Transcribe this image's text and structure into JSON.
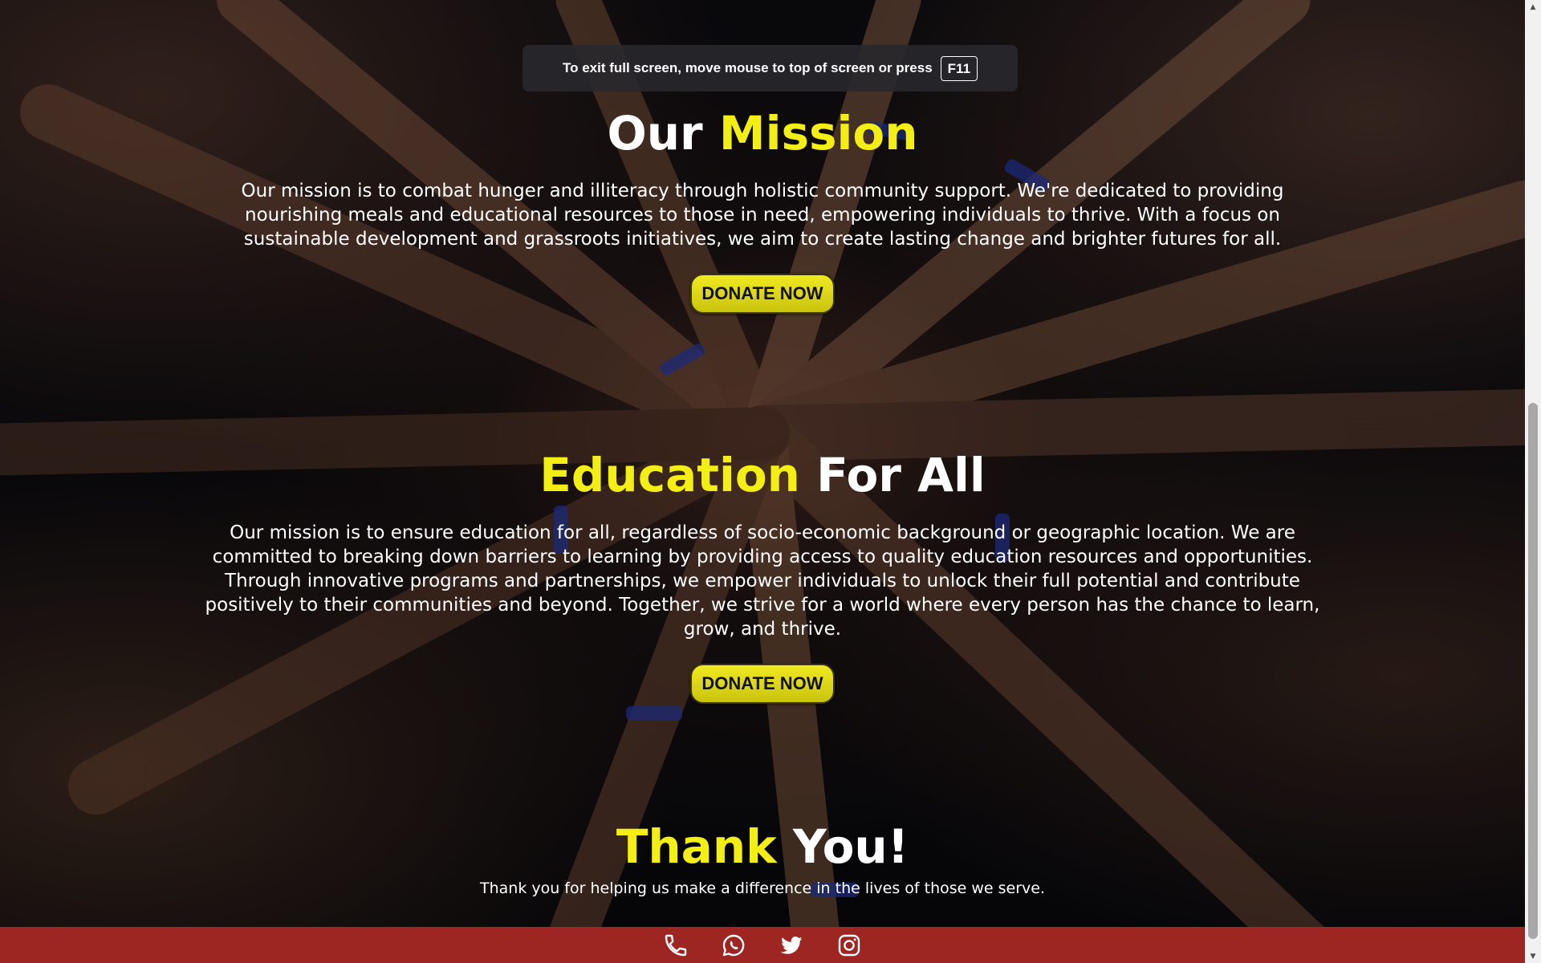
{
  "fullscreen_notice": {
    "text": "To exit full screen, move mouse to top of screen or press",
    "key": "F11"
  },
  "mission": {
    "title_white": "Our",
    "title_yellow": "Mission",
    "text": "Our mission is to combat hunger and illiteracy through holistic community support. We're dedicated to providing nourishing meals and educational resources to those in need, empowering individuals to thrive. With a focus on sustainable development and grassroots initiatives, we aim to create lasting change and brighter futures for all.",
    "button": "DONATE NOW"
  },
  "education": {
    "title_yellow": "Education",
    "title_white": "For All",
    "text": "Our mission is to ensure education for all, regardless of socio-economic background or geographic location. We are committed to breaking down barriers to learning by providing access to quality education resources and opportunities. Through innovative programs and partnerships, we empower individuals to unlock their full potential and contribute positively to their communities and beyond. Together, we strive for a world where every person has the chance to learn, grow, and thrive.",
    "button": "DONATE NOW"
  },
  "thanks": {
    "title_yellow": "Thank",
    "title_white": "You!",
    "text": "Thank you for helping us make a difference in the lives of those we serve."
  },
  "footer": {
    "icons": [
      "phone-icon",
      "whatsapp-icon",
      "twitter-icon",
      "instagram-icon"
    ]
  },
  "colors": {
    "accent_yellow": "#f4ef13",
    "footer_red": "#9e2622"
  }
}
